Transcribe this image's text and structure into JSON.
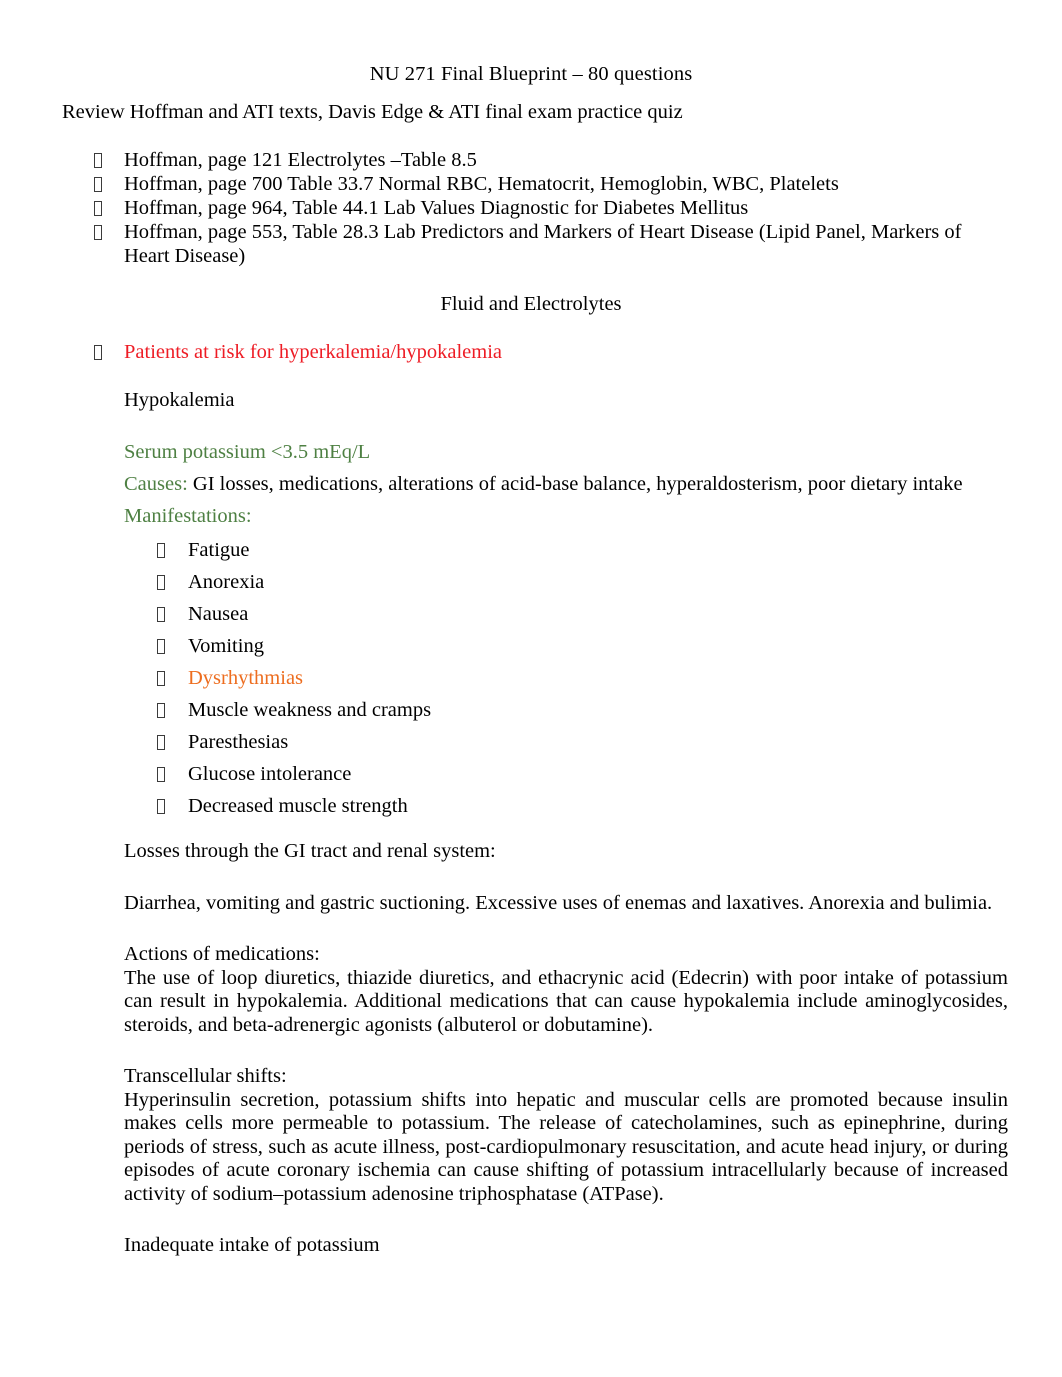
{
  "document": {
    "title": "NU 271 Final Blueprint – 80 questions",
    "review_line": "Review Hoffman and ATI texts, Davis Edge & ATI final exam practice quiz",
    "bullet_glyph": "missing-glyph-box"
  },
  "colors": {
    "text": "#000000",
    "red": "#ee1c25",
    "green": "#4e8043",
    "orange": "#ed6d1f",
    "highlight_shadow": "rgba(0,0,0,0.05)"
  },
  "references": [
    {
      "text": "Hoffman, page 121 Electrolytes –Table 8.5"
    },
    {
      "text": "Hoffman, page 700 Table 33.7 Normal RBC, Hematocrit, Hemoglobin, WBC, Platelets"
    },
    {
      "text": "Hoffman, page 964, Table 44.1 Lab Values Diagnostic for Diabetes Mellitus"
    },
    {
      "text": "Hoffman, page 553, Table 28.3 Lab Predictors and Markers of Heart Disease (Lipid Panel, Markers of Heart Disease)"
    }
  ],
  "section": {
    "heading": "Fluid and Electrolytes",
    "risk_bullet": "Patients at risk for hyperkalemia/hypokalemia"
  },
  "hypokalemia": {
    "heading": "Hypokalemia",
    "serum_label": "Serum potassium  <3.5 mEq/L",
    "causes_label": "Causes:",
    "causes_text": " GI losses, medications, alterations of acid-base balance, hyperaldosterism, poor dietary intake",
    "manifestations_label": "Manifestations:",
    "manifestations": [
      {
        "text": "Fatigue",
        "color": "black"
      },
      {
        "text": "Anorexia",
        "color": "black"
      },
      {
        "text": "Nausea",
        "color": "black"
      },
      {
        "text": "Vomiting",
        "color": "black"
      },
      {
        "text": "Dysrhythmias",
        "color": "orange"
      },
      {
        "text": "Muscle weakness and cramps",
        "color": "black"
      },
      {
        "text": "Paresthesias",
        "color": "black"
      },
      {
        "text": "Glucose intolerance",
        "color": "black"
      },
      {
        "text": "Decreased muscle strength",
        "color": "black"
      }
    ],
    "losses_heading": "Losses through the GI tract and renal system:",
    "losses_body": "Diarrhea, vomiting and gastric suctioning. Excessive uses of enemas and laxatives. Anorexia and bulimia.",
    "medications_heading": "Actions of medications:",
    "medications_body": "The use of loop diuretics, thiazide diuretics, and ethacrynic acid (Edecrin) with poor intake of potassium can result in hypokalemia. Additional medications that can cause hypokalemia include aminoglycosides, steroids, and beta-adrenergic agonists (albuterol or dobutamine).",
    "transcellular_heading": "Transcellular shifts:",
    "transcellular_body": "Hyperinsulin secretion, potassium shifts into hepatic and muscular cells are promoted because insulin makes cells more permeable to potassium. The release of catecholamines, such as epinephrine, during periods of stress, such as acute illness, post-cardiopulmonary resuscitation, and acute head injury, or during episodes of acute coronary ischemia can cause shifting of potassium intracellularly because of increased activity of sodium–potassium adenosine triphosphatase (ATPase).",
    "inadequate_heading": "Inadequate intake of potassium"
  }
}
